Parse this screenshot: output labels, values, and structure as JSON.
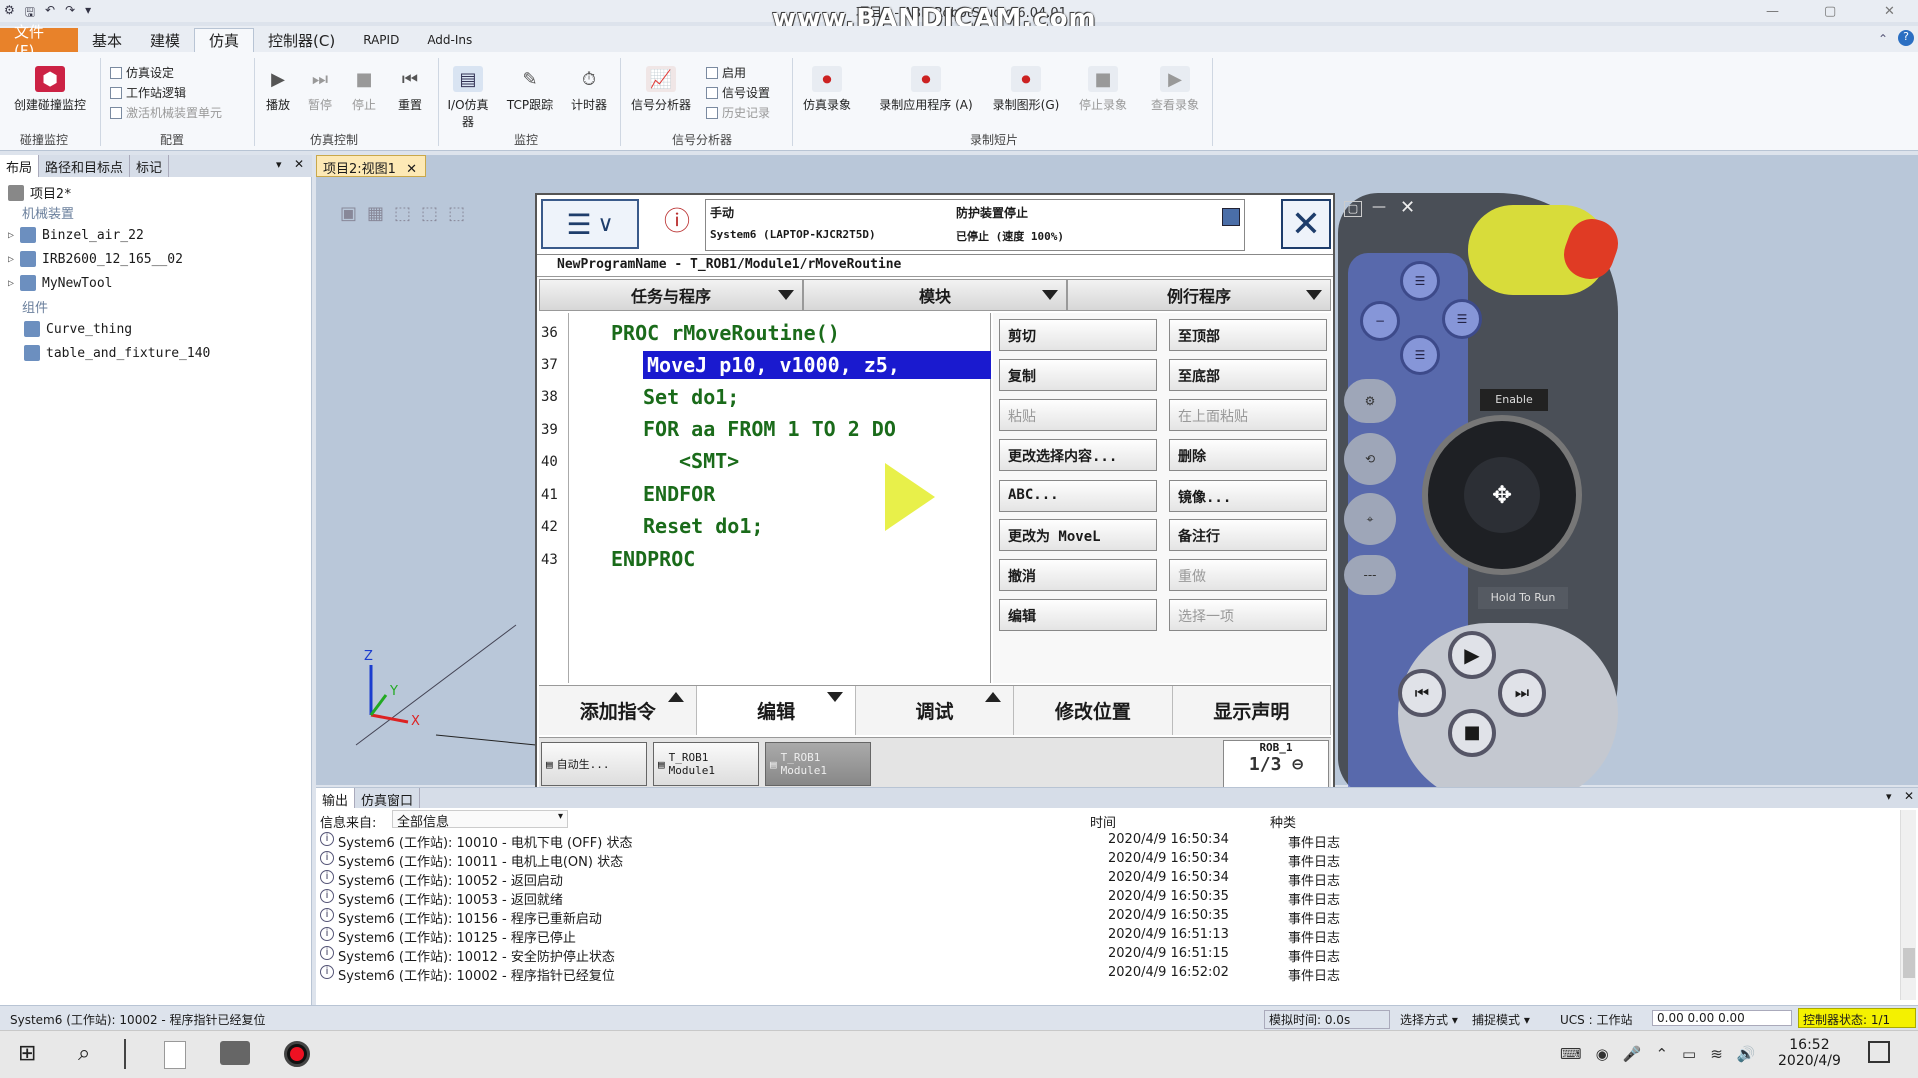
{
  "titlebar": {
    "title": "项目2 - ABB RobotStudio 6.04.01",
    "watermark": "www.BANDICAM.com"
  },
  "ribbon_tabs": [
    "文件 (F)",
    "基本",
    "建模",
    "仿真",
    "控制器(C)",
    "RAPID",
    "Add-Ins"
  ],
  "ribbon": {
    "collision": {
      "btn": "创建碰撞监控",
      "group": "碰撞监控"
    },
    "config": {
      "sim_setup": "仿真设定",
      "station_logic": "工作站逻辑",
      "activate_unit": "激活机械装置单元",
      "group": "配置"
    },
    "sim_control": {
      "play": "播放",
      "pause": "暂停",
      "stop": "停止",
      "reset": "重置",
      "group": "仿真控制"
    },
    "monitor": {
      "io_sim": "I/O仿真器",
      "tcp": "TCP跟踪",
      "timer": "计时器",
      "group": "监控"
    },
    "signal": {
      "analyzer": "信号分析器",
      "enable": "启用",
      "settings": "信号设置",
      "history": "历史记录",
      "group": "信号分析器"
    },
    "record": {
      "sim_rec": "仿真录象",
      "rec_app": "录制应用程序 (A)",
      "rec_graph": "录制图形(G)",
      "stop_rec": "停止录象",
      "view_rec": "查看录象",
      "group": "录制短片"
    }
  },
  "left_panel": {
    "tabs": [
      "布局",
      "路径和目标点",
      "标记"
    ],
    "project": "项目2*",
    "cat_mech": "机械装置",
    "items_mech": [
      "Binzel_air_22",
      "IRB2600_12_165__02",
      "MyNewTool"
    ],
    "cat_comp": "组件",
    "items_comp": [
      "Curve_thing",
      "table_and_fixture_140"
    ]
  },
  "viewport": {
    "tab": "项目2:视图1"
  },
  "flexpendant": {
    "status_mode": "手动",
    "status_system": "System6 (LAPTOP-KJCR2T5D)",
    "status_guard": "防护装置停止",
    "status_speed": "已停止 (速度 100%)",
    "path": "NewProgramName - T_ROB1/Module1/rMoveRoutine",
    "columns": [
      "任务与程序",
      "模块",
      "例行程序"
    ],
    "line_numbers": [
      "36",
      "37",
      "38",
      "39",
      "40",
      "41",
      "42",
      "43"
    ],
    "code": [
      "PROC rMoveRoutine()",
      "MoveJ p10, v1000, z5,",
      "Set do1;",
      "FOR aa FROM 1 TO 2 DO",
      "<SMT>",
      "ENDFOR",
      "Reset do1;",
      "ENDPROC"
    ],
    "menu": {
      "cut": "剪切",
      "top": "至顶部",
      "copy": "复制",
      "bottom": "至底部",
      "paste": "粘贴",
      "paste_above": "在上面粘贴",
      "change_sel": "更改选择内容...",
      "delete": "删除",
      "abc": "ABC...",
      "mirror": "镜像...",
      "change_movel": "更改为 MoveL",
      "comment": "备注行",
      "undo": "撤消",
      "redo": "重做",
      "edit": "编辑",
      "select_one": "选择一项"
    },
    "bottom": [
      "添加指令",
      "编辑",
      "调试",
      "修改位置",
      "显示声明"
    ],
    "tasks": [
      {
        "label": "自动生..."
      },
      {
        "label": "T_ROB1 Module1"
      },
      {
        "label": "T_ROB1 Module1"
      }
    ],
    "rob": "ROB_1",
    "rob_frac": "1/3"
  },
  "pendant": {
    "enable": "Enable",
    "hold": "Hold To Run"
  },
  "output": {
    "tabs": [
      "输出",
      "仿真窗口"
    ],
    "source_label": "信息来自:",
    "source_value": "全部信息",
    "col_time": "时间",
    "col_type": "种类",
    "rows": [
      {
        "msg": "System6 (工作站): 10010 - 电机下电 (OFF) 状态",
        "time": "2020/4/9 16:50:34",
        "type": "事件日志"
      },
      {
        "msg": "System6 (工作站): 10011 - 电机上电(ON) 状态",
        "time": "2020/4/9 16:50:34",
        "type": "事件日志"
      },
      {
        "msg": "System6 (工作站): 10052 - 返回启动",
        "time": "2020/4/9 16:50:34",
        "type": "事件日志"
      },
      {
        "msg": "System6 (工作站): 10053 - 返回就绪",
        "time": "2020/4/9 16:50:35",
        "type": "事件日志"
      },
      {
        "msg": "System6 (工作站): 10156 - 程序已重新启动",
        "time": "2020/4/9 16:50:35",
        "type": "事件日志"
      },
      {
        "msg": "System6 (工作站): 10125 - 程序已停止",
        "time": "2020/4/9 16:51:13",
        "type": "事件日志"
      },
      {
        "msg": "System6 (工作站): 10012 - 安全防护停止状态",
        "time": "2020/4/9 16:51:15",
        "type": "事件日志"
      },
      {
        "msg": "System6 (工作站): 10002 - 程序指针已经复位",
        "time": "2020/4/9 16:52:02",
        "type": "事件日志"
      }
    ]
  },
  "statusbar": {
    "message": "System6 (工作站): 10002 - 程序指针已经复位",
    "sim_time": "模拟时间: 0.0s",
    "select_mode": "选择方式",
    "snap_mode": "捕捉模式",
    "ucs": "UCS : 工作站",
    "coords": "0.00   0.00   0.00",
    "controller": "控制器状态: 1/1"
  },
  "taskbar": {
    "time": "16:52",
    "date": "2020/4/9"
  }
}
